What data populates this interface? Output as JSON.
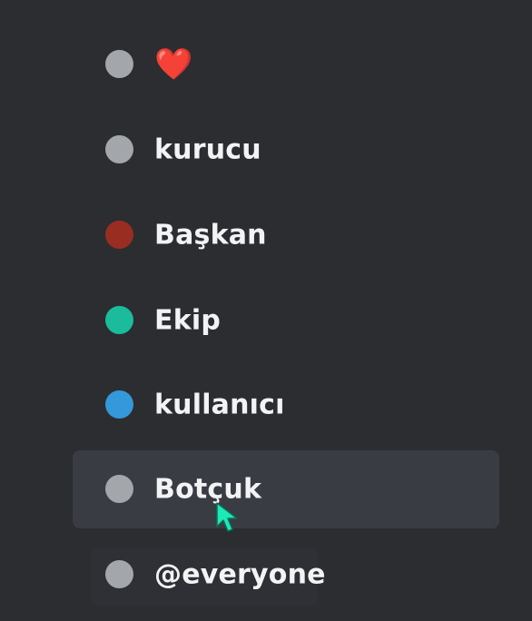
{
  "roles": [
    {
      "label": "❤️",
      "color": "#a3a6aa",
      "hovered": false
    },
    {
      "label": "kurucu",
      "color": "#a3a6aa",
      "hovered": false
    },
    {
      "label": "Başkan",
      "color": "#992d22",
      "hovered": false
    },
    {
      "label": "Ekip",
      "color": "#1abc9c",
      "hovered": false
    },
    {
      "label": "kullanıcı",
      "color": "#3498db",
      "hovered": false
    },
    {
      "label": "Botçuk",
      "color": "#a3a6aa",
      "hovered": true
    },
    {
      "label": "@everyone",
      "color": "#a3a6aa",
      "hovered": false
    }
  ],
  "cursor": {
    "icon": "mouse-pointer-icon",
    "color": "#1de9b6"
  }
}
